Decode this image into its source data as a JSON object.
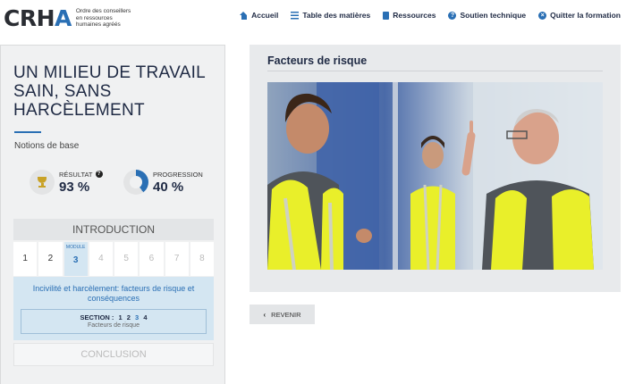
{
  "header": {
    "logo_text": "CRHA",
    "logo_tagline": "Ordre des conseillers en ressources humaines agréés",
    "nav": [
      {
        "label": "Accueil",
        "icon": "home-icon"
      },
      {
        "label": "Table des matières",
        "icon": "list-icon"
      },
      {
        "label": "Ressources",
        "icon": "book-icon"
      },
      {
        "label": "Soutien technique",
        "icon": "help-circle-icon"
      },
      {
        "label": "Quitter la formation",
        "icon": "close-circle-icon"
      }
    ]
  },
  "sidebar": {
    "course_title": "UN MILIEU DE TRAVAIL SAIN, SANS HARCÈLEMENT",
    "subtitle": "Notions de base",
    "result": {
      "label": "RÉSULTAT",
      "value": "93 %",
      "icon": "trophy-icon"
    },
    "progress": {
      "label": "PROGRESSION",
      "value": "40 %",
      "fraction": 0.4,
      "icon": "progress-pie-icon"
    },
    "intro_label": "INTRODUCTION",
    "modules": {
      "tag": "MODULE",
      "items": [
        "1",
        "2",
        "3",
        "4",
        "5",
        "6",
        "7",
        "8"
      ],
      "active": "3"
    },
    "module_name": "Incivilité et harcèlement: facteurs de risque et conséquences",
    "section": {
      "label": "SECTION :",
      "items": [
        "1",
        "2",
        "3",
        "4"
      ],
      "current": "3",
      "name": "Facteurs de risque"
    },
    "conclusion_label": "CONCLUSION"
  },
  "content": {
    "title": "Facteurs de risque"
  },
  "back_button": {
    "label": "REVENIR",
    "icon": "chevron-left-icon"
  },
  "colors": {
    "accent": "#2a6fb4",
    "navy": "#1f2a44",
    "vest": "#e9ef2a"
  }
}
